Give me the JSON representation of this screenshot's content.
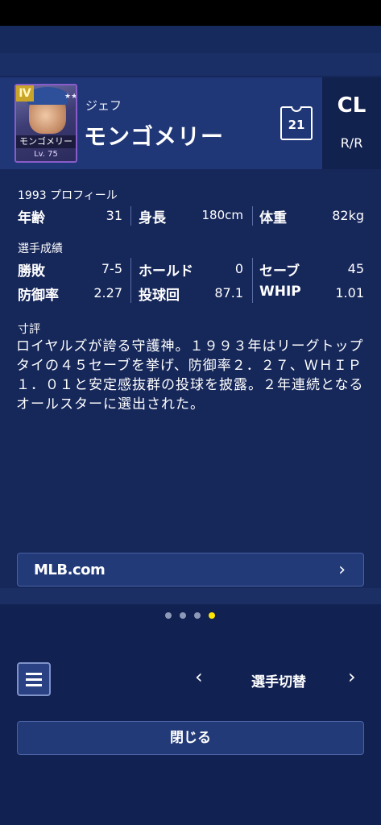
{
  "player": {
    "first_name": "ジェフ",
    "last_name": "モンゴメリー",
    "card_name": "モンゴメリー",
    "card_level": "Lv. 75",
    "card_rank": "Ⅳ",
    "card_stars": "★★★★★",
    "uniform_number": "21",
    "league": "CL",
    "handedness": "R/R"
  },
  "profile": {
    "section_label": "1993 プロフィール",
    "age_label": "年齢",
    "age_value": "31",
    "height_label": "身長",
    "height_value": "180cm",
    "weight_label": "体重",
    "weight_value": "82kg"
  },
  "stats": {
    "section_label": "選手成績",
    "win_loss_label": "勝敗",
    "win_loss_value": "7-5",
    "holds_label": "ホールド",
    "holds_value": "0",
    "saves_label": "セーブ",
    "saves_value": "45",
    "era_label": "防御率",
    "era_value": "2.27",
    "innings_label": "投球回",
    "innings_value": "87.1",
    "whip_label": "WHIP",
    "whip_value": "1.01"
  },
  "comment": {
    "section_label": "寸評",
    "text": "ロイヤルズが誇る守護神。１９９３年はリーグトップタイの４５セーブを挙げ、防御率２．２７、ＷＨＩＰ１．０１と安定感抜群の投球を披露。２年連続となるオールスターに選出された。"
  },
  "links": {
    "mlb_label": "MLB.com",
    "chevron_icon": "chevron-right-icon"
  },
  "pager": {
    "count": 4,
    "active_index": 3,
    "active_color": "#ffe600"
  },
  "footer": {
    "menu_icon": "menu-icon",
    "switch_label": "選手切替",
    "prev_symbol": "‹",
    "next_symbol": "›",
    "close_label": "閉じる"
  },
  "colors": {
    "background": "#16275a",
    "header": "#1f3677",
    "button": "#233a78"
  }
}
